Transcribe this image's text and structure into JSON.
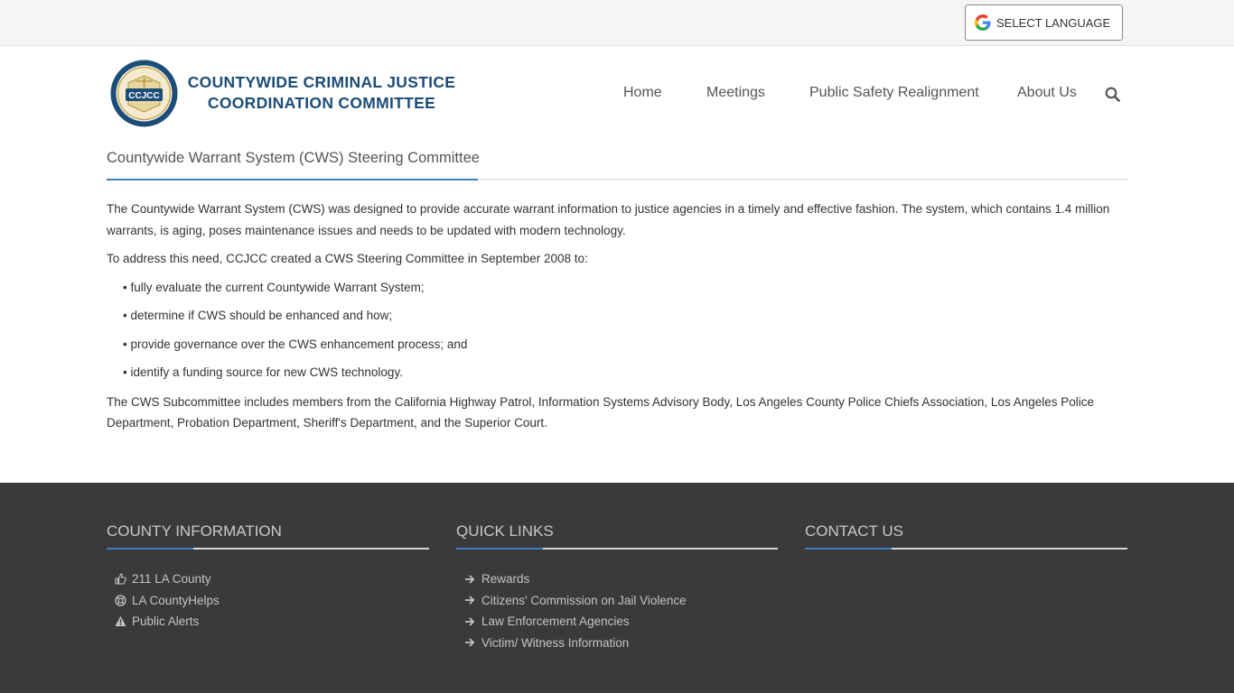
{
  "topbar": {
    "language_button": "SELECT LANGUAGE"
  },
  "header": {
    "logo_line1": "COUNTYWIDE CRIMINAL JUSTICE",
    "logo_line2": "COORDINATION COMMITTEE",
    "seal_text": "CCJCC"
  },
  "nav": [
    "Home",
    "Meetings",
    "Public Safety Realignment",
    "About Us"
  ],
  "main": {
    "title": "Countywide Warrant System (CWS) Steering Committee",
    "para1": "The Countywide Warrant System (CWS) was designed to provide accurate warrant information to justice agencies in a timely and effective fashion. The system, which contains 1.4 million warrants, is aging, poses maintenance issues and needs to be updated with modern technology.",
    "para2": "To address this need, CCJCC created a CWS Steering Committee in September 2008 to:",
    "bullets": [
      "• fully evaluate the current Countywide Warrant System;",
      "• determine if CWS should be enhanced and how;",
      "• provide governance over the CWS enhancement process; and",
      "• identify a funding source for new CWS technology."
    ],
    "para3": "The CWS Subcommittee includes members from the California Highway Patrol, Information Systems Advisory Body, Los Angeles County Police Chiefs Association, Los Angeles Police Department, Probation Department, Sheriff's Department, and the Superior Court."
  },
  "footer": {
    "county_title": "COUNTY INFORMATION",
    "county_items": [
      {
        "label": "211 LA County",
        "icon": "thumbs-up-icon"
      },
      {
        "label": "LA CountyHelps",
        "icon": "lifebuoy-icon"
      },
      {
        "label": "Public Alerts",
        "icon": "warning-icon"
      }
    ],
    "quick_title": "QUICK LINKS",
    "quick_items": [
      {
        "label": "Rewards",
        "icon": "arrow-right-icon"
      },
      {
        "label": "Citizens' Commission on Jail Violence",
        "icon": "arrow-right-icon"
      },
      {
        "label": "Law Enforcement Agencies",
        "icon": "arrow-right-icon"
      },
      {
        "label": "Victim/ Witness Information",
        "icon": "arrow-right-icon"
      }
    ],
    "contact_title": "CONTACT US"
  },
  "colors": {
    "accent": "#3d7fc1",
    "logo_blue": "#1c4d78",
    "footer_bg": "#3a3a3a"
  }
}
